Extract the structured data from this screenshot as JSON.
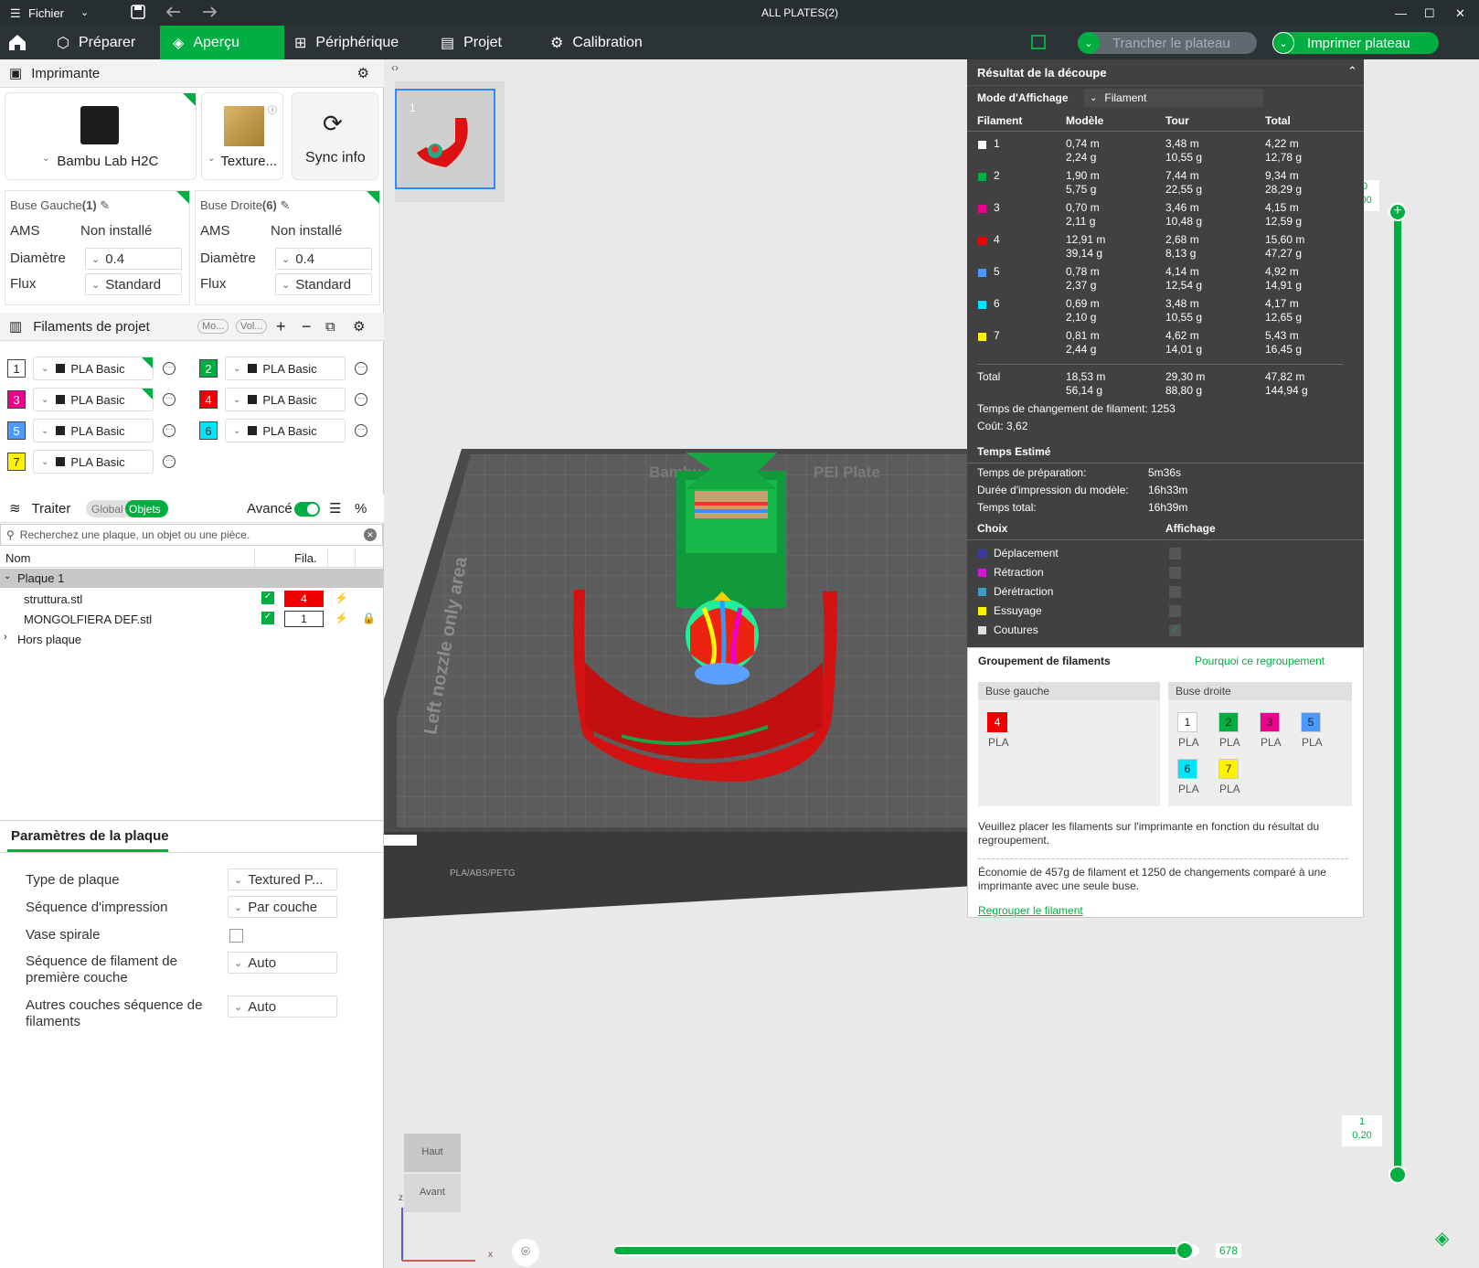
{
  "titlebar": {
    "menu": "Fichier",
    "title": "ALL PLATES(2)"
  },
  "menubar": {
    "tabs": [
      "Préparer",
      "Aperçu",
      "Périphérique",
      "Projet",
      "Calibration"
    ],
    "slice_btn": "Trancher le plateau",
    "print_btn": "Imprimer plateau"
  },
  "printer": {
    "header": "Imprimante",
    "name": "Bambu Lab H2C",
    "plate": "Texture...",
    "sync": "Sync info"
  },
  "nozzle_left": {
    "title": "Buse Gauche",
    "count": "(1)",
    "ams_label": "AMS",
    "ams_value": "Non installé",
    "diam_label": "Diamètre",
    "diam": "0.4",
    "flux_label": "Flux",
    "flux": "Standard"
  },
  "nozzle_right": {
    "title": "Buse Droite",
    "count": "(6)",
    "ams_label": "AMS",
    "ams_value": "Non installé",
    "diam_label": "Diamètre",
    "diam": "0.4",
    "flux_label": "Flux",
    "flux": "Standard"
  },
  "filaments": {
    "header": "Filaments de projet",
    "pill1": "Mo...",
    "pill2": "Vol...",
    "items": [
      {
        "num": "1",
        "color": "#ffffff",
        "text_color": "#222",
        "name": "PLA Basic"
      },
      {
        "num": "2",
        "color": "#00ae42",
        "text_color": "#fff",
        "name": "PLA Basic"
      },
      {
        "num": "3",
        "color": "#ec008c",
        "text_color": "#fff",
        "name": "PLA Basic"
      },
      {
        "num": "4",
        "color": "#f00000",
        "text_color": "#fff",
        "name": "PLA Basic"
      },
      {
        "num": "5",
        "color": "#4c9aff",
        "text_color": "#fff",
        "name": "PLA Basic"
      },
      {
        "num": "6",
        "color": "#00e5ff",
        "text_color": "#222",
        "name": "PLA Basic"
      },
      {
        "num": "7",
        "color": "#fff200",
        "text_color": "#222",
        "name": "PLA Basic"
      }
    ]
  },
  "process": {
    "header": "Traiter",
    "global": "Global",
    "objects": "Objets",
    "advanced": "Avancé",
    "search_placeholder": "Recherchez une plaque, un objet ou une pièce."
  },
  "objects": {
    "col_name": "Nom",
    "col_fila": "Fila.",
    "plate": "Plaque 1",
    "items": [
      {
        "name": "struttura.stl",
        "fila": "4"
      },
      {
        "name": "MONGOLFIERA DEF.stl",
        "fila": "1"
      }
    ],
    "outside": "Hors plaque"
  },
  "plate_params": {
    "tab": "Paramètres de la plaque",
    "rows": [
      {
        "label": "Type de plaque",
        "value": "Textured P..."
      },
      {
        "label": "Séquence d'impression",
        "value": "Par couche"
      },
      {
        "label": "Vase spirale",
        "value": ""
      },
      {
        "label": "Séquence de filament de première couche",
        "value": "Auto"
      },
      {
        "label": "Autres couches séquence de filaments",
        "value": "Auto"
      }
    ]
  },
  "viewport": {
    "plate_thumb_num": "1",
    "bed_label": "Bambu",
    "bed_label2": "PEI Plate",
    "side_text": "Left nozzle only area",
    "bottom_strip": "PLA/ABS/PETG",
    "cube_top": "Haut",
    "cube_front": "Avant",
    "axis_z": "z",
    "axis_x": "x",
    "vslider_top1": "250",
    "vslider_top2": "50,00",
    "vslider_bot1": "1",
    "vslider_bot2": "0,20",
    "hslider_value": "678"
  },
  "slice": {
    "title": "Résultat de la découpe",
    "mode_label": "Mode d'Affichage",
    "mode_value": "Filament",
    "cols": [
      "Filament",
      "Modèle",
      "Tour",
      "Total"
    ],
    "rows": [
      {
        "id": "1",
        "color": "#ffffff",
        "m1": "0,74 m",
        "m2": "2,24 g",
        "t1": "3,48 m",
        "t2": "10,55 g",
        "s1": "4,22 m",
        "s2": "12,78 g"
      },
      {
        "id": "2",
        "color": "#00ae42",
        "m1": "1,90 m",
        "m2": "5,75 g",
        "t1": "7,44 m",
        "t2": "22,55 g",
        "s1": "9,34 m",
        "s2": "28,29 g"
      },
      {
        "id": "3",
        "color": "#ec008c",
        "m1": "0,70 m",
        "m2": "2,11 g",
        "t1": "3,46 m",
        "t2": "10,48 g",
        "s1": "4,15 m",
        "s2": "12,59 g"
      },
      {
        "id": "4",
        "color": "#f00000",
        "m1": "12,91 m",
        "m2": "39,14 g",
        "t1": "2,68 m",
        "t2": "8,13 g",
        "s1": "15,60 m",
        "s2": "47,27 g"
      },
      {
        "id": "5",
        "color": "#4c9aff",
        "m1": "0,78 m",
        "m2": "2,37 g",
        "t1": "4,14 m",
        "t2": "12,54 g",
        "s1": "4,92 m",
        "s2": "14,91 g"
      },
      {
        "id": "6",
        "color": "#00e5ff",
        "m1": "0,69 m",
        "m2": "2,10 g",
        "t1": "3,48 m",
        "t2": "10,55 g",
        "s1": "4,17 m",
        "s2": "12,65 g"
      },
      {
        "id": "7",
        "color": "#fff200",
        "m1": "0,81 m",
        "m2": "2,44 g",
        "t1": "4,62 m",
        "t2": "14,01 g",
        "s1": "5,43 m",
        "s2": "16,45 g"
      }
    ],
    "total": {
      "label": "Total",
      "m1": "18,53 m",
      "m2": "56,14 g",
      "t1": "29,30 m",
      "t2": "88,80 g",
      "s1": "47,82 m",
      "s2": "144,94 g"
    },
    "change_label": "Temps de changement de filament:",
    "change_value": "1253",
    "cost_label": "Coût:",
    "cost_value": "3,62",
    "time_header": "Temps Estimé",
    "prep_label": "Temps de préparation:",
    "prep_value": "5m36s",
    "model_label": "Durée d'impression du modèle:",
    "model_value": "16h33m",
    "total_label": "Temps total:",
    "total_value": "16h39m",
    "choice_h": "Choix",
    "display_h": "Affichage",
    "choices": [
      {
        "name": "Déplacement",
        "color": "#3a3aa6"
      },
      {
        "name": "Rétraction",
        "color": "#d018d0"
      },
      {
        "name": "Dérétraction",
        "color": "#3d9ec2"
      },
      {
        "name": "Essuyage",
        "color": "#fff200"
      },
      {
        "name": "Coutures",
        "color": "#e0e0e0"
      }
    ]
  },
  "grouping": {
    "title": "Groupement de filaments",
    "why": "Pourquoi ce regroupement",
    "left_title": "Buse gauche",
    "right_title": "Buse droite",
    "pla": "PLA",
    "note": "Veuillez placer les filaments sur l'imprimante en fonction du résultat du regroupement.",
    "saving": "Économie de 457g de filament et 1250 de changements comparé à une imprimante avec une seule buse.",
    "regroup": "Regrouper le filament"
  }
}
